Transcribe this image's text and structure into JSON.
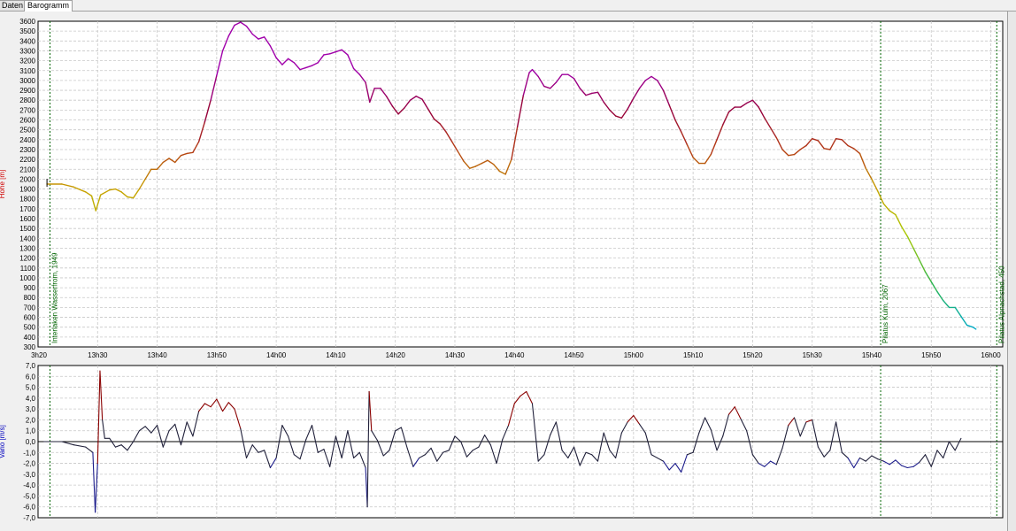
{
  "tabs": [
    {
      "label": "Daten",
      "active": false
    },
    {
      "label": "Barogramm",
      "active": true
    }
  ],
  "colors": {
    "grid": "#c8c8c8",
    "axis": "#000000",
    "waypoint": "#006400",
    "alt_label": "#d00000",
    "vario_label": "#0000c0",
    "vario_line": "#20203a"
  },
  "chart_data": [
    {
      "type": "line",
      "name": "altitude",
      "ylabel": "Höhe [m]",
      "ylim": [
        300,
        3600
      ],
      "yticks": [
        300,
        400,
        500,
        600,
        700,
        800,
        900,
        1000,
        1100,
        1200,
        1300,
        1400,
        1500,
        1600,
        1700,
        1800,
        1900,
        2000,
        2100,
        2200,
        2300,
        2400,
        2500,
        2600,
        2700,
        2800,
        2900,
        3000,
        3100,
        3200,
        3300,
        3400,
        3500,
        3600
      ],
      "xlim": [
        800,
        962
      ],
      "xticks": [
        {
          "v": 800,
          "label": "3h20"
        },
        {
          "v": 810,
          "label": "13h30"
        },
        {
          "v": 820,
          "label": "13h40"
        },
        {
          "v": 830,
          "label": "13h50"
        },
        {
          "v": 840,
          "label": "14h00"
        },
        {
          "v": 850,
          "label": "14h10"
        },
        {
          "v": 860,
          "label": "14h20"
        },
        {
          "v": 870,
          "label": "14h30"
        },
        {
          "v": 880,
          "label": "14h40"
        },
        {
          "v": 890,
          "label": "14h50"
        },
        {
          "v": 900,
          "label": "15h00"
        },
        {
          "v": 910,
          "label": "15h10"
        },
        {
          "v": 920,
          "label": "15h20"
        },
        {
          "v": 930,
          "label": "15h30"
        },
        {
          "v": 940,
          "label": "15h40"
        },
        {
          "v": 950,
          "label": "15h50"
        },
        {
          "v": 960,
          "label": "16h00"
        }
      ],
      "waypoints": [
        {
          "t": 802,
          "label": "Interlaken Wasserfrom, 1949"
        },
        {
          "t": 941.5,
          "label": "Pilatus Kulm, 2067"
        },
        {
          "t": 961,
          "label": "Pilatus Alpnachstad, 450"
        }
      ],
      "points": [
        [
          801.5,
          1950
        ],
        [
          804,
          1950
        ],
        [
          806,
          1920
        ],
        [
          808,
          1870
        ],
        [
          809,
          1830
        ],
        [
          809.7,
          1680
        ],
        [
          810.5,
          1840
        ],
        [
          812,
          1890
        ],
        [
          813,
          1900
        ],
        [
          814,
          1870
        ],
        [
          815,
          1820
        ],
        [
          816,
          1810
        ],
        [
          817,
          1900
        ],
        [
          818,
          2000
        ],
        [
          819,
          2100
        ],
        [
          820,
          2100
        ],
        [
          821,
          2170
        ],
        [
          822,
          2210
        ],
        [
          823,
          2170
        ],
        [
          824,
          2240
        ],
        [
          825,
          2260
        ],
        [
          826,
          2270
        ],
        [
          827,
          2380
        ],
        [
          828,
          2580
        ],
        [
          829,
          2800
        ],
        [
          830,
          3050
        ],
        [
          831,
          3300
        ],
        [
          832,
          3450
        ],
        [
          833,
          3560
        ],
        [
          834,
          3590
        ],
        [
          835,
          3550
        ],
        [
          836,
          3470
        ],
        [
          837,
          3420
        ],
        [
          838,
          3440
        ],
        [
          839,
          3350
        ],
        [
          840,
          3230
        ],
        [
          841,
          3160
        ],
        [
          842,
          3220
        ],
        [
          843,
          3180
        ],
        [
          844,
          3110
        ],
        [
          845,
          3130
        ],
        [
          846,
          3150
        ],
        [
          847,
          3180
        ],
        [
          848,
          3260
        ],
        [
          849,
          3270
        ],
        [
          850,
          3290
        ],
        [
          851,
          3310
        ],
        [
          852,
          3260
        ],
        [
          853,
          3120
        ],
        [
          854,
          3060
        ],
        [
          855,
          2980
        ],
        [
          855.7,
          2780
        ],
        [
          856.5,
          2920
        ],
        [
          857.5,
          2920
        ],
        [
          858.5,
          2840
        ],
        [
          859.5,
          2740
        ],
        [
          860.5,
          2660
        ],
        [
          861.5,
          2720
        ],
        [
          862.5,
          2800
        ],
        [
          863.5,
          2840
        ],
        [
          864.5,
          2810
        ],
        [
          865.5,
          2710
        ],
        [
          866.5,
          2610
        ],
        [
          867.5,
          2560
        ],
        [
          868.5,
          2480
        ],
        [
          869.5,
          2380
        ],
        [
          870.5,
          2280
        ],
        [
          871.5,
          2180
        ],
        [
          872.5,
          2110
        ],
        [
          873.5,
          2130
        ],
        [
          874.5,
          2160
        ],
        [
          875.5,
          2190
        ],
        [
          876.5,
          2150
        ],
        [
          877.5,
          2080
        ],
        [
          878.5,
          2050
        ],
        [
          879.5,
          2200
        ],
        [
          880.5,
          2530
        ],
        [
          881.5,
          2850
        ],
        [
          882.5,
          3080
        ],
        [
          883,
          3110
        ],
        [
          884,
          3040
        ],
        [
          885,
          2940
        ],
        [
          886,
          2920
        ],
        [
          887,
          2980
        ],
        [
          888,
          3060
        ],
        [
          889,
          3060
        ],
        [
          890,
          3020
        ],
        [
          891,
          2920
        ],
        [
          892,
          2850
        ],
        [
          893,
          2870
        ],
        [
          894,
          2880
        ],
        [
          895,
          2780
        ],
        [
          896,
          2700
        ],
        [
          897,
          2640
        ],
        [
          898,
          2620
        ],
        [
          899,
          2710
        ],
        [
          900,
          2820
        ],
        [
          901,
          2920
        ],
        [
          902,
          3000
        ],
        [
          903,
          3040
        ],
        [
          904,
          3000
        ],
        [
          905,
          2900
        ],
        [
          906,
          2750
        ],
        [
          907,
          2600
        ],
        [
          908,
          2480
        ],
        [
          909,
          2350
        ],
        [
          910,
          2220
        ],
        [
          911,
          2160
        ],
        [
          912,
          2160
        ],
        [
          913,
          2250
        ],
        [
          914,
          2400
        ],
        [
          915,
          2550
        ],
        [
          916,
          2680
        ],
        [
          917,
          2730
        ],
        [
          918,
          2730
        ],
        [
          919,
          2770
        ],
        [
          920,
          2800
        ],
        [
          921,
          2730
        ],
        [
          922,
          2620
        ],
        [
          923,
          2520
        ],
        [
          924,
          2420
        ],
        [
          925,
          2300
        ],
        [
          926,
          2240
        ],
        [
          927,
          2250
        ],
        [
          928,
          2300
        ],
        [
          929,
          2340
        ],
        [
          930,
          2410
        ],
        [
          931,
          2390
        ],
        [
          932,
          2310
        ],
        [
          933,
          2300
        ],
        [
          934,
          2410
        ],
        [
          935,
          2400
        ],
        [
          936,
          2340
        ],
        [
          937,
          2310
        ],
        [
          938,
          2260
        ],
        [
          939,
          2110
        ],
        [
          940,
          2000
        ],
        [
          941,
          1880
        ],
        [
          942,
          1750
        ],
        [
          943,
          1680
        ],
        [
          944,
          1640
        ],
        [
          945,
          1520
        ],
        [
          946,
          1420
        ],
        [
          947,
          1300
        ],
        [
          948,
          1180
        ],
        [
          949,
          1060
        ],
        [
          950,
          960
        ],
        [
          951,
          860
        ],
        [
          952,
          770
        ],
        [
          953,
          700
        ],
        [
          954,
          700
        ],
        [
          955,
          610
        ],
        [
          956,
          520
        ],
        [
          957,
          500
        ],
        [
          957.5,
          480
        ]
      ]
    },
    {
      "type": "line",
      "name": "vario",
      "ylabel": "Vario [m/s]",
      "ylim": [
        -7,
        7
      ],
      "yticks": [
        {
          "v": 7,
          "label": "7,0"
        },
        {
          "v": 6,
          "label": "6,0"
        },
        {
          "v": 5,
          "label": "5,0"
        },
        {
          "v": 4,
          "label": "4,0"
        },
        {
          "v": 3,
          "label": "3,0"
        },
        {
          "v": 2,
          "label": "2,0"
        },
        {
          "v": 1,
          "label": "1,0"
        },
        {
          "v": 0,
          "label": "0,0"
        },
        {
          "v": -1,
          "label": "-1,0"
        },
        {
          "v": -2,
          "label": "-2,0"
        },
        {
          "v": -3,
          "label": "-3,0"
        },
        {
          "v": -4,
          "label": "-4,0"
        },
        {
          "v": -5,
          "label": "-5,0"
        },
        {
          "v": -6,
          "label": "-6,0"
        },
        {
          "v": -7,
          "label": "-7,0"
        }
      ],
      "points": [
        [
          801,
          0
        ],
        [
          804,
          0
        ],
        [
          806,
          -0.3
        ],
        [
          808,
          -0.5
        ],
        [
          809.2,
          -1
        ],
        [
          809.6,
          -6.5
        ],
        [
          810,
          -2
        ],
        [
          810.4,
          6.5
        ],
        [
          810.8,
          2
        ],
        [
          811.2,
          0.3
        ],
        [
          812,
          0.3
        ],
        [
          813,
          -0.5
        ],
        [
          814,
          -0.3
        ],
        [
          815,
          -0.8
        ],
        [
          816,
          0
        ],
        [
          817,
          1
        ],
        [
          818,
          1.4
        ],
        [
          819,
          0.8
        ],
        [
          820,
          1.5
        ],
        [
          821,
          -0.5
        ],
        [
          822,
          1
        ],
        [
          823,
          1.6
        ],
        [
          824,
          -0.3
        ],
        [
          825,
          1.8
        ],
        [
          826,
          0.5
        ],
        [
          827,
          2.8
        ],
        [
          828,
          3.5
        ],
        [
          829,
          3.2
        ],
        [
          830,
          3.9
        ],
        [
          831,
          2.8
        ],
        [
          832,
          3.6
        ],
        [
          833,
          3
        ],
        [
          834,
          1.2
        ],
        [
          835,
          -1.5
        ],
        [
          836,
          -0.3
        ],
        [
          837,
          -1
        ],
        [
          838,
          -0.8
        ],
        [
          839,
          -2.4
        ],
        [
          840,
          -1.5
        ],
        [
          841,
          1.5
        ],
        [
          842,
          0.5
        ],
        [
          843,
          -1.2
        ],
        [
          844,
          -1.6
        ],
        [
          845,
          0.2
        ],
        [
          846,
          1.5
        ],
        [
          847,
          -1
        ],
        [
          848,
          -0.7
        ],
        [
          849,
          -2.3
        ],
        [
          850,
          0.5
        ],
        [
          851,
          -1.5
        ],
        [
          852,
          1
        ],
        [
          853,
          -1.5
        ],
        [
          854,
          -1
        ],
        [
          855,
          -2.4
        ],
        [
          855.3,
          -6
        ],
        [
          855.6,
          4.6
        ],
        [
          856,
          1
        ],
        [
          857,
          0.1
        ],
        [
          858,
          -1.3
        ],
        [
          859,
          -0.8
        ],
        [
          860,
          1
        ],
        [
          861,
          1.3
        ],
        [
          862,
          -0.6
        ],
        [
          863,
          -2.3
        ],
        [
          864,
          -1.5
        ],
        [
          865,
          -1.2
        ],
        [
          866,
          -0.6
        ],
        [
          867,
          -1.8
        ],
        [
          868,
          -1
        ],
        [
          869,
          -0.8
        ],
        [
          870,
          0.5
        ],
        [
          871,
          0
        ],
        [
          872,
          -1.4
        ],
        [
          873,
          -0.8
        ],
        [
          874,
          -0.5
        ],
        [
          875,
          0.6
        ],
        [
          876,
          -0.3
        ],
        [
          877,
          -2
        ],
        [
          878,
          0.2
        ],
        [
          879,
          1.5
        ],
        [
          880,
          3.5
        ],
        [
          881,
          4.2
        ],
        [
          882,
          4.6
        ],
        [
          883,
          3.5
        ],
        [
          884,
          -1.8
        ],
        [
          885,
          -1.2
        ],
        [
          886,
          0.6
        ],
        [
          887,
          1.8
        ],
        [
          888,
          -0.8
        ],
        [
          889,
          -1.5
        ],
        [
          890,
          -0.5
        ],
        [
          891,
          -2.2
        ],
        [
          892,
          -1
        ],
        [
          893,
          -1.2
        ],
        [
          894,
          -1.8
        ],
        [
          895,
          0.8
        ],
        [
          896,
          -0.8
        ],
        [
          897,
          -1.5
        ],
        [
          898,
          0.8
        ],
        [
          899,
          1.8
        ],
        [
          900,
          2.4
        ],
        [
          901,
          1.6
        ],
        [
          902,
          0.8
        ],
        [
          903,
          -1.2
        ],
        [
          904,
          -1.5
        ],
        [
          905,
          -1.8
        ],
        [
          906,
          -2.6
        ],
        [
          907,
          -2
        ],
        [
          908,
          -2.8
        ],
        [
          909,
          -1.2
        ],
        [
          910,
          -1
        ],
        [
          911,
          0.8
        ],
        [
          912,
          2.2
        ],
        [
          913,
          1.1
        ],
        [
          914,
          -0.8
        ],
        [
          915,
          0.5
        ],
        [
          916,
          2.5
        ],
        [
          917,
          3.2
        ],
        [
          918,
          2.1
        ],
        [
          919,
          1
        ],
        [
          920,
          -1.2
        ],
        [
          921,
          -2
        ],
        [
          922,
          -2.3
        ],
        [
          923,
          -1.8
        ],
        [
          924,
          -2.1
        ],
        [
          925,
          -0.6
        ],
        [
          926,
          1.5
        ],
        [
          927,
          2.2
        ],
        [
          928,
          0.5
        ],
        [
          929,
          1.8
        ],
        [
          930,
          2
        ],
        [
          931,
          -0.5
        ],
        [
          932,
          -1.4
        ],
        [
          933,
          -0.8
        ],
        [
          934,
          1.8
        ],
        [
          935,
          -1
        ],
        [
          936,
          -1.5
        ],
        [
          937,
          -2.4
        ],
        [
          938,
          -1.5
        ],
        [
          939,
          -1.8
        ],
        [
          940,
          -1.3
        ],
        [
          941,
          -1.6
        ],
        [
          942,
          -1.8
        ],
        [
          943,
          -2.1
        ],
        [
          944,
          -1.7
        ],
        [
          945,
          -2.2
        ],
        [
          946,
          -2.4
        ],
        [
          947,
          -2.3
        ],
        [
          948,
          -1.9
        ],
        [
          949,
          -1.2
        ],
        [
          950,
          -2.3
        ],
        [
          951,
          -0.8
        ],
        [
          952,
          -1.5
        ],
        [
          953,
          0
        ],
        [
          954,
          -0.8
        ],
        [
          955,
          0.3
        ]
      ]
    }
  ]
}
